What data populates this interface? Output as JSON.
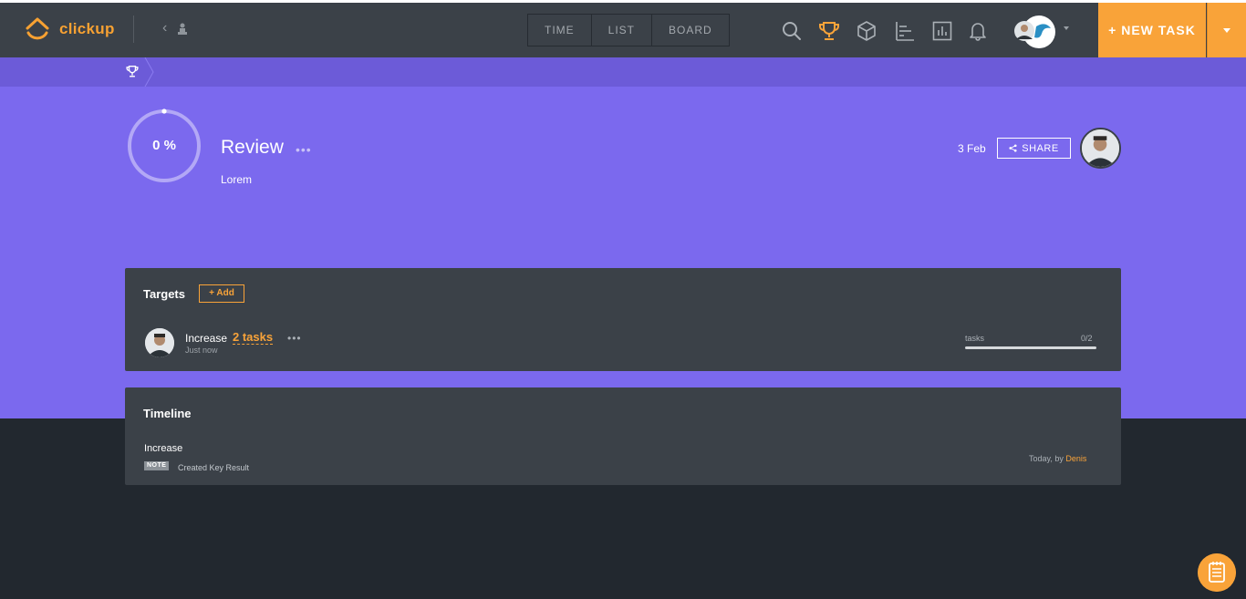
{
  "header": {
    "logo_text": "clickup",
    "view_tabs": [
      "TIME",
      "LIST",
      "BOARD"
    ],
    "new_task_label": "+ NEW TASK"
  },
  "goal": {
    "progress_text": "0 %",
    "progress": 0,
    "title": "Review",
    "description": "Lorem",
    "date": "3 Feb",
    "share_label": "SHARE"
  },
  "targets": {
    "title": "Targets",
    "add_label": "+ Add",
    "items": [
      {
        "name": "Increase",
        "link_text": "2 tasks",
        "time": "Just now",
        "metric_label": "tasks",
        "metric_value": "0/2",
        "progress": 0
      }
    ]
  },
  "timeline": {
    "title": "Timeline",
    "items": [
      {
        "title": "Increase",
        "badge": "NOTE",
        "action": "Created Key Result",
        "when": "Today, by",
        "who": "Denis"
      }
    ]
  },
  "colors": {
    "accent": "#f9a339",
    "purple": "#7b69ee",
    "purple_dark": "#6c5bd8",
    "card": "#3b4148",
    "background": "#22282f"
  }
}
